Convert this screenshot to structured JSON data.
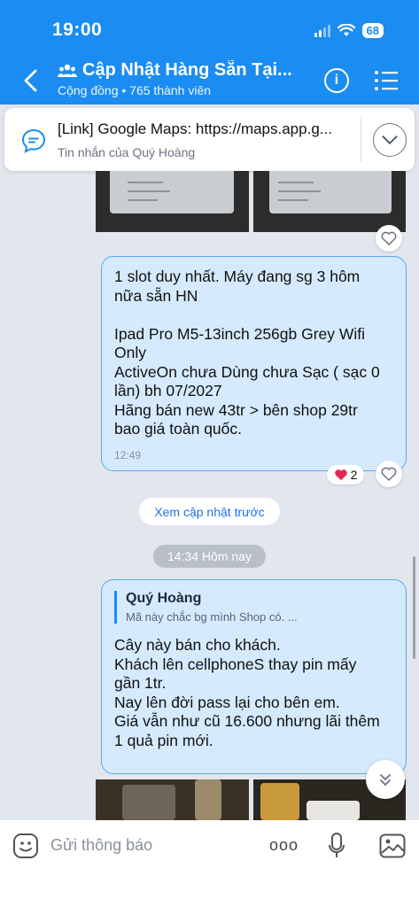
{
  "status": {
    "time": "19:00",
    "battery": "68"
  },
  "header": {
    "title": "Cập Nhật Hàng Sẵn Tại...",
    "subtitle": "Cộng đồng • 765 thành viên"
  },
  "pinned": {
    "title": "[Link] Google Maps: https://maps.app.g...",
    "subtitle": "Tin nhắn của Quý Hoàng"
  },
  "messages": [
    {
      "lines": [
        "1 slot duy nhất. Máy đang sg 3 hôm",
        "nữa sẵn HN",
        "",
        "Ipad Pro M5-13inch 256gb Grey Wifi",
        "Only",
        "ActiveOn chưa Dùng chưa Sạc ( sạc 0",
        "lần) bh 07/2027",
        "Hãng bán new 43tr > bên shop 29tr",
        "bao giá toàn quốc."
      ],
      "time": "12:49",
      "reaction_count": "2"
    },
    {
      "quote_name": "Quý Hoàng",
      "quote_text": "Mã này chắc bg mình Shop có. ...",
      "lines": [
        "Cây này bán cho khách.",
        "Khách lên cellphoneS thay pin mấy",
        "gần 1tr.",
        "Nay lên đời pass lại cho bên em.",
        "Giá vẫn như cũ 16.600 nhưng lãi thêm",
        "1 quả pin mới."
      ]
    }
  ],
  "see_previous": "Xem cập nhật trước",
  "date_separator": "14:34 Hôm nay",
  "composer": {
    "placeholder": "Gửi thông báo",
    "more": "ooo"
  },
  "colors": {
    "header": "#1a8cf2",
    "bubble": "#d5eafd",
    "bubble_border": "#5aa8f0",
    "link": "#1a73e8"
  }
}
